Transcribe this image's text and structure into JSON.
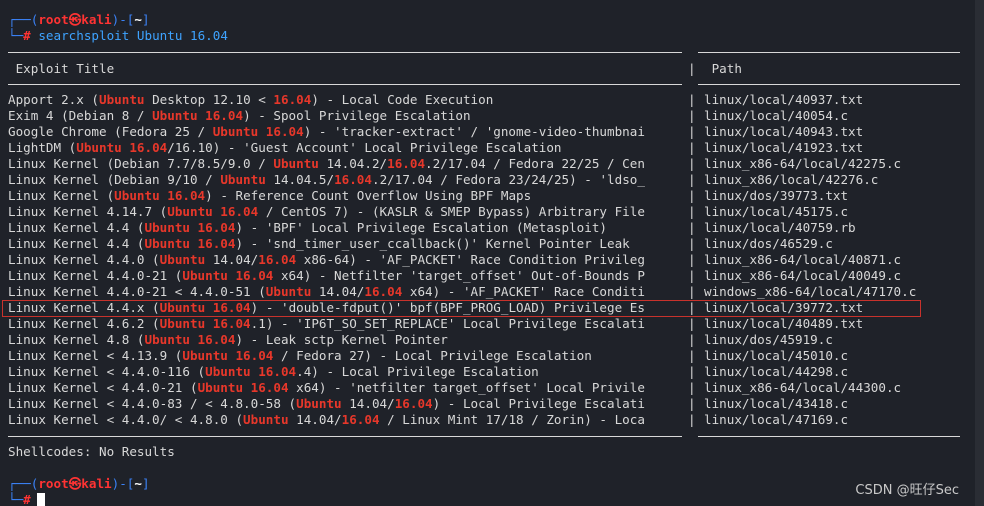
{
  "prompt1": {
    "open": "┌──(",
    "user": "root",
    "at": "㉿",
    "host": "kali",
    "mid": ")-[",
    "path": "~",
    "close": "]",
    "second": "└─",
    "hash": "#",
    "command": " searchsploit Ubuntu 16.04"
  },
  "table": {
    "title_header": " Exploit Title",
    "path_header": " Path",
    "rows": [
      {
        "segments": [
          "Apport 2.x (",
          "Ubuntu",
          " Desktop 12.10 < ",
          "16.04",
          ") - Local Code Execution"
        ],
        "path": "linux/local/40937.txt"
      },
      {
        "segments": [
          "Exim 4 (Debian 8 / ",
          "Ubuntu 16.04",
          ") - Spool Privilege Escalation"
        ],
        "path": "linux/local/40054.c"
      },
      {
        "segments": [
          "Google Chrome (Fedora 25 / ",
          "Ubuntu 16.04",
          ") - 'tracker-extract' / 'gnome-video-thumbnai"
        ],
        "path": "linux/local/40943.txt"
      },
      {
        "segments": [
          "LightDM (",
          "Ubuntu 16.04",
          "/16.10) - 'Guest Account' Local Privilege Escalation"
        ],
        "path": "linux/local/41923.txt"
      },
      {
        "segments": [
          "Linux Kernel (Debian 7.7/8.5/9.0 / ",
          "Ubuntu",
          " 14.04.2/",
          "16.04",
          ".2/17.04 / Fedora 22/25 / Cen"
        ],
        "path": "linux_x86-64/local/42275.c"
      },
      {
        "segments": [
          "Linux Kernel (Debian 9/10 / ",
          "Ubuntu",
          " 14.04.5/",
          "16.04",
          ".2/17.04 / Fedora 23/24/25) - 'ldso_"
        ],
        "path": "linux_x86/local/42276.c"
      },
      {
        "segments": [
          "Linux Kernel (",
          "Ubuntu 16.04",
          ") - Reference Count Overflow Using BPF Maps"
        ],
        "path": "linux/dos/39773.txt"
      },
      {
        "segments": [
          "Linux Kernel 4.14.7 (",
          "Ubuntu 16.04",
          " / CentOS 7) - (KASLR & SMEP Bypass) Arbitrary File"
        ],
        "path": "linux/local/45175.c"
      },
      {
        "segments": [
          "Linux Kernel 4.4 (",
          "Ubuntu 16.04",
          ") - 'BPF' Local Privilege Escalation (Metasploit)"
        ],
        "path": "linux/local/40759.rb"
      },
      {
        "segments": [
          "Linux Kernel 4.4 (",
          "Ubuntu 16.04",
          ") - 'snd_timer_user_ccallback()' Kernel Pointer Leak"
        ],
        "path": "linux/dos/46529.c"
      },
      {
        "segments": [
          "Linux Kernel 4.4.0 (",
          "Ubuntu",
          " 14.04/",
          "16.04",
          " x86-64) - 'AF_PACKET' Race Condition Privileg"
        ],
        "path": "linux_x86-64/local/40871.c"
      },
      {
        "segments": [
          "Linux Kernel 4.4.0-21 (",
          "Ubuntu 16.04",
          " x64) - Netfilter 'target_offset' Out-of-Bounds P"
        ],
        "path": "linux_x86-64/local/40049.c"
      },
      {
        "segments": [
          "Linux Kernel 4.4.0-21 < 4.4.0-51 (",
          "Ubuntu",
          " 14.04/",
          "16.04",
          " x64) - 'AF_PACKET' Race Conditi"
        ],
        "path": "windows_x86-64/local/47170.c"
      },
      {
        "segments": [
          "Linux Kernel 4.4.x (",
          "Ubuntu 16.04",
          ") - 'double-fdput()' bpf(BPF_PROG_LOAD) Privilege Es"
        ],
        "path": "linux/local/39772.txt"
      },
      {
        "segments": [
          "Linux Kernel 4.6.2 (",
          "Ubuntu 16.04",
          ".1) - 'IP6T_SO_SET_REPLACE' Local Privilege Escalati"
        ],
        "path": "linux/local/40489.txt"
      },
      {
        "segments": [
          "Linux Kernel 4.8 (",
          "Ubuntu 16.04",
          ") - Leak sctp Kernel Pointer"
        ],
        "path": "linux/dos/45919.c"
      },
      {
        "segments": [
          "Linux Kernel < 4.13.9 (",
          "Ubuntu 16.04",
          " / Fedora 27) - Local Privilege Escalation"
        ],
        "path": "linux/local/45010.c"
      },
      {
        "segments": [
          "Linux Kernel < 4.4.0-116 (",
          "Ubuntu 16.04",
          ".4) - Local Privilege Escalation"
        ],
        "path": "linux/local/44298.c"
      },
      {
        "segments": [
          "Linux Kernel < 4.4.0-21 (",
          "Ubuntu 16.04",
          " x64) - 'netfilter target_offset' Local Privile"
        ],
        "path": "linux_x86-64/local/44300.c"
      },
      {
        "segments": [
          "Linux Kernel < 4.4.0-83 / < 4.8.0-58 (",
          "Ubuntu",
          " 14.04/",
          "16.04",
          ") - Local Privilege Escalati"
        ],
        "path": "linux/local/43418.c"
      },
      {
        "segments": [
          "Linux Kernel < 4.4.0/ < 4.8.0 (",
          "Ubuntu",
          " 14.04/",
          "16.04",
          " / Linux Mint 17/18 / Zorin) - Loca"
        ],
        "path": "linux/local/47169.c"
      }
    ]
  },
  "shellcodes": "Shellcodes: No Results",
  "prompt2": {
    "open": "┌──(",
    "user": "root",
    "at": "㉿",
    "host": "kali",
    "mid": ")-[",
    "path": "~",
    "close": "]",
    "second": "└─",
    "hash": "#"
  },
  "watermark": "CSDN @旺仔Sec",
  "colors": {
    "background": "#1f2229",
    "prompt_blue": "#3b82f6",
    "keyword_red": "#e7372a",
    "highlight_border": "#c8322c"
  }
}
